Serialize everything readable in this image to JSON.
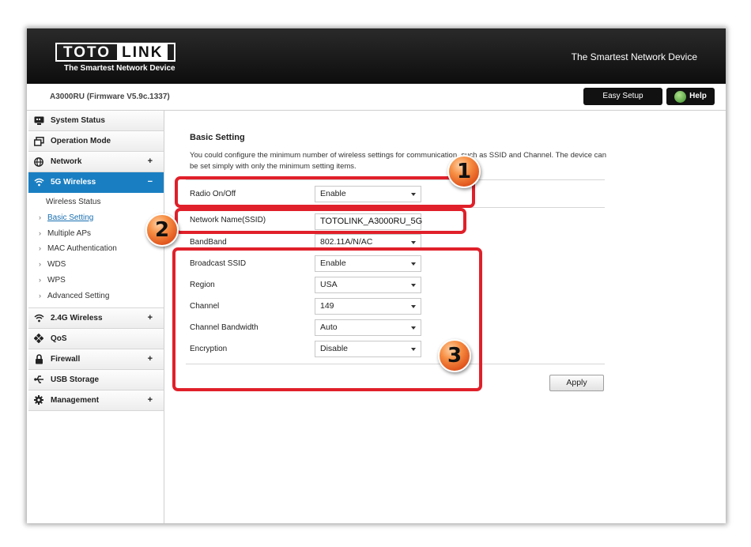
{
  "header": {
    "logo_toto": "TOTO",
    "logo_link": "LINK",
    "logo_tagline": "The Smartest Network Device",
    "tagline": "The Smartest Network Device"
  },
  "subbar": {
    "model": "A3000RU (Firmware V5.9c.1337)",
    "easy_setup": "Easy Setup",
    "help": "Help"
  },
  "sidebar": {
    "items": [
      {
        "label": "System Status",
        "icon": "monitor-icon",
        "plus": ""
      },
      {
        "label": "Operation Mode",
        "icon": "windows-icon",
        "plus": ""
      },
      {
        "label": "Network",
        "icon": "globe-icon",
        "plus": "+"
      },
      {
        "label": "5G Wireless",
        "icon": "wifi-icon",
        "plus": "−"
      },
      {
        "label": "2.4G Wireless",
        "icon": "wifi-icon",
        "plus": "+"
      },
      {
        "label": "QoS",
        "icon": "qos-icon",
        "plus": ""
      },
      {
        "label": "Firewall",
        "icon": "lock-icon",
        "plus": "+"
      },
      {
        "label": "USB Storage",
        "icon": "usb-icon",
        "plus": ""
      },
      {
        "label": "Management",
        "icon": "gear-icon",
        "plus": "+"
      }
    ],
    "sub_5g": [
      "Wireless Status",
      "Basic Setting",
      "Multiple APs",
      "MAC Authentication",
      "WDS",
      "WPS",
      "Advanced Setting"
    ]
  },
  "content": {
    "title": "Basic Setting",
    "description": "You could configure the minimum number of wireless settings for communication, such as SSID and Channel. The device can be set simply with only the minimum setting items.",
    "fields": {
      "radio": {
        "label": "Radio On/Off",
        "value": "Enable"
      },
      "ssid": {
        "label": "Network Name(SSID)",
        "value": "TOTOLINK_A3000RU_5G"
      },
      "band": {
        "label": "BandBand",
        "value": "802.11A/N/AC"
      },
      "broadcast": {
        "label": "Broadcast SSID",
        "value": "Enable"
      },
      "region": {
        "label": "Region",
        "value": "USA"
      },
      "channel": {
        "label": "Channel",
        "value": "149"
      },
      "bandwidth": {
        "label": "Channel Bandwidth",
        "value": "Auto"
      },
      "encryption": {
        "label": "Encryption",
        "value": "Disable"
      }
    },
    "apply": "Apply"
  },
  "annotations": {
    "one": "1",
    "two": "2",
    "three": "3",
    "color": "#e0202a"
  }
}
